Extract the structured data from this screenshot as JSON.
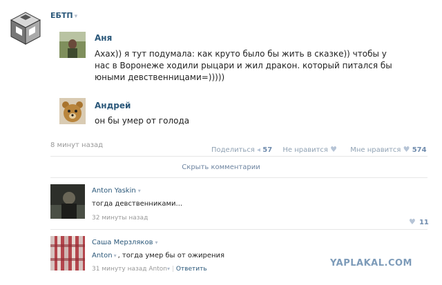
{
  "group": {
    "name": "ЕБТП",
    "caret": "▾"
  },
  "post": {
    "messages": [
      {
        "author": "Аня",
        "lines": [
          "Ахах)) я тут подумала: как круто было бы жить в сказке)) чтобы у",
          "нас в Воронеже ходили рыцари и жил дракон. который питался бы",
          "юными девственницами=)))))"
        ]
      },
      {
        "author": "Андрей",
        "lines": [
          "он бы умер от голода"
        ]
      }
    ],
    "time": "8 минут назад",
    "share_label": "Поделиться",
    "share_count": "57",
    "dislike_label": "Не нравится",
    "like_label": "Мне нравится",
    "like_count": "574",
    "hide_comments": "Скрыть комментарии"
  },
  "comments": [
    {
      "author": "Anton Yaskin",
      "text": "тогда девственниками...",
      "time": "32 минуты назад",
      "likes": "11"
    },
    {
      "author": "Саша Мерзляков",
      "reply_to": "Anton",
      "text": ", тогда умер бы от ожирения",
      "time": "31 минуту назад",
      "reply_to_meta": "Anton",
      "answer_label": "Ответить"
    }
  ],
  "watermark": "YAPLAKAL.COM",
  "colors": {
    "link": "#2b587a",
    "muted": "#999999",
    "accent": "#6f8bad"
  }
}
